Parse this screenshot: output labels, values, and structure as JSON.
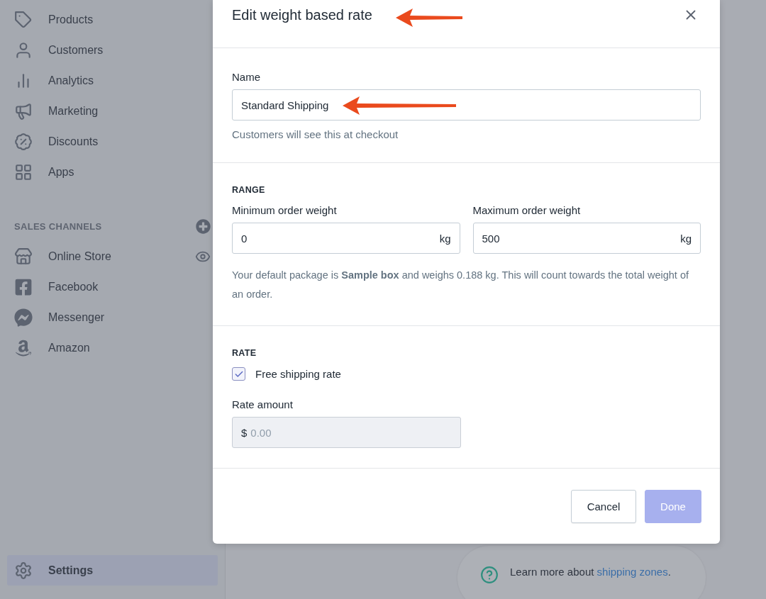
{
  "sidebar": {
    "items": [
      {
        "label": "Products",
        "kind": "tag"
      },
      {
        "label": "Customers",
        "kind": "person"
      },
      {
        "label": "Analytics",
        "kind": "chart"
      },
      {
        "label": "Marketing",
        "kind": "megaphone"
      },
      {
        "label": "Discounts",
        "kind": "percent"
      },
      {
        "label": "Apps",
        "kind": "apps"
      }
    ],
    "sales_channels": {
      "title": "SALES CHANNELS",
      "items": [
        {
          "label": "Online Store",
          "kind": "store",
          "eye_button": true
        },
        {
          "label": "Facebook",
          "kind": "facebook"
        },
        {
          "label": "Messenger",
          "kind": "messenger"
        },
        {
          "label": "Amazon",
          "kind": "amazon"
        }
      ]
    },
    "settings": {
      "label": "Settings",
      "selected": true
    }
  },
  "modal": {
    "title": "Edit weight based rate",
    "title_marked": true,
    "name": {
      "label": "Name",
      "value": "Standard Shipping",
      "marked": true,
      "help": "Customers will see this at checkout"
    },
    "range": {
      "heading": "RANGE",
      "fields": [
        {
          "label": "Minimum order weight",
          "value": "0",
          "unit": "kg"
        },
        {
          "label": "Maximum order weight",
          "value": "500",
          "unit": "kg"
        }
      ],
      "note": "Your default package is **Sample box** and weighs 0.188 kg. This will count towards the total weight of an order."
    },
    "rate": {
      "heading": "RATE",
      "checkbox": {
        "label": "Free shipping rate",
        "checked": true
      },
      "amount": {
        "label": "Rate amount",
        "prefix": "$",
        "placeholder": "0.00",
        "disabled": true
      }
    },
    "buttons": [
      {
        "label": "Cancel",
        "kind": "secondary",
        "disabled": false
      },
      {
        "label": "Done",
        "kind": "primary",
        "disabled": true
      }
    ]
  },
  "help_card": {
    "text": "Learn more about ",
    "link": "shipping zones",
    "suffix": "."
  }
}
